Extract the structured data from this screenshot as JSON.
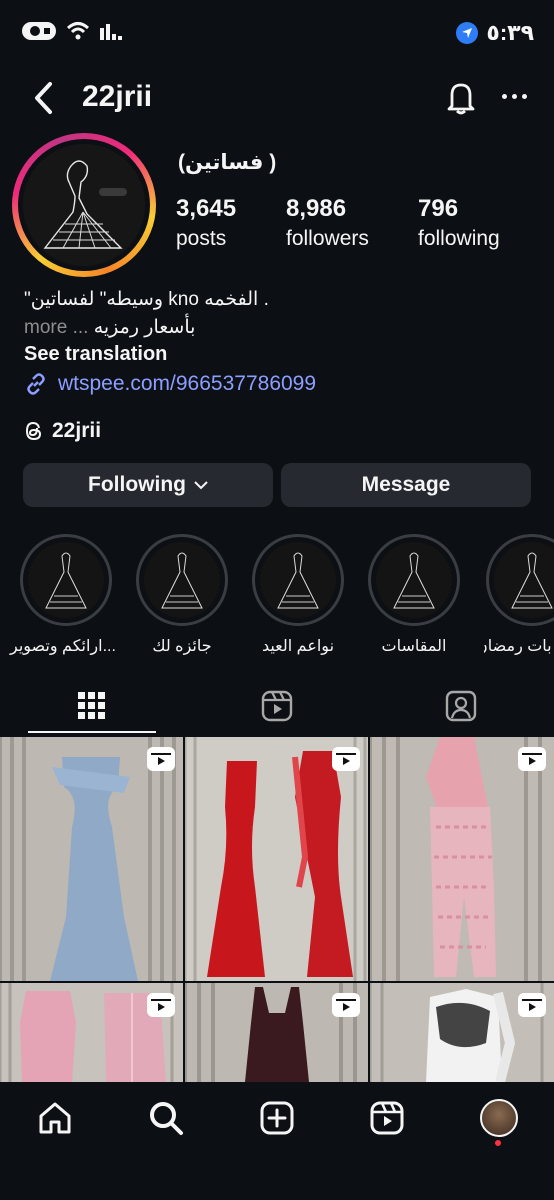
{
  "status_bar": {
    "time": "٥:٣٩",
    "icons": [
      "camera-icon",
      "wifi-icon",
      "cellular-icon",
      "location-icon"
    ]
  },
  "header": {
    "username": "22jrii",
    "icons": [
      "back-icon",
      "bell-icon",
      "more-icon"
    ]
  },
  "profile": {
    "display_name": "(فساتين )",
    "stats": [
      {
        "value": "3,645",
        "label": "posts"
      },
      {
        "value": "8,986",
        "label": "followers"
      },
      {
        "value": "796",
        "label": "following"
      }
    ],
    "bio_line1": "\"وسيطه\" لفساتين kno الفخمه .",
    "bio_line2": "بأسعار رمزيه",
    "bio_more": "more",
    "see_translation": "See translation",
    "link": "wtspee.com/966537786099",
    "threads_handle": "22jrii"
  },
  "buttons": {
    "following": "Following",
    "message": "Message"
  },
  "highlights": [
    {
      "label": "ارائكم وتصوير..."
    },
    {
      "label": "جائزه لك"
    },
    {
      "label": "نواعم العيد"
    },
    {
      "label": "المقاسات"
    },
    {
      "label": "بات رمضان"
    }
  ],
  "tabs": [
    {
      "name": "grid",
      "icon": "grid-icon",
      "active": true
    },
    {
      "name": "reels",
      "icon": "reels-icon",
      "active": false
    },
    {
      "name": "tagged",
      "icon": "tagged-icon",
      "active": false
    }
  ],
  "posts": [
    {
      "dress": "light blue off-shoulder gown",
      "color": "#8fa9c7",
      "type": "reel"
    },
    {
      "dress": "red mermaid gowns",
      "color": "#c8161d",
      "type": "reel"
    },
    {
      "dress": "pink feathered jumpsuit",
      "color": "#e7a5b0",
      "type": "reel"
    },
    {
      "dress": "pink dress with cardigan",
      "color": "#e5a3b6",
      "type": "reel"
    },
    {
      "dress": "dark wine dress",
      "color": "#3a1a1e",
      "type": "reel"
    },
    {
      "dress": "white dress with black bodice",
      "color": "#eeeeee",
      "type": "reel"
    }
  ],
  "bottom_nav": [
    {
      "name": "home",
      "icon": "home-icon"
    },
    {
      "name": "search",
      "icon": "search-icon"
    },
    {
      "name": "create",
      "icon": "add-post-icon"
    },
    {
      "name": "reels",
      "icon": "reels-icon"
    },
    {
      "name": "profile",
      "icon": "profile-avatar"
    }
  ],
  "colors": {
    "background": "#0c1014",
    "link": "#8c9eff",
    "button": "#262a30",
    "notification_dot": "#ff3040"
  }
}
